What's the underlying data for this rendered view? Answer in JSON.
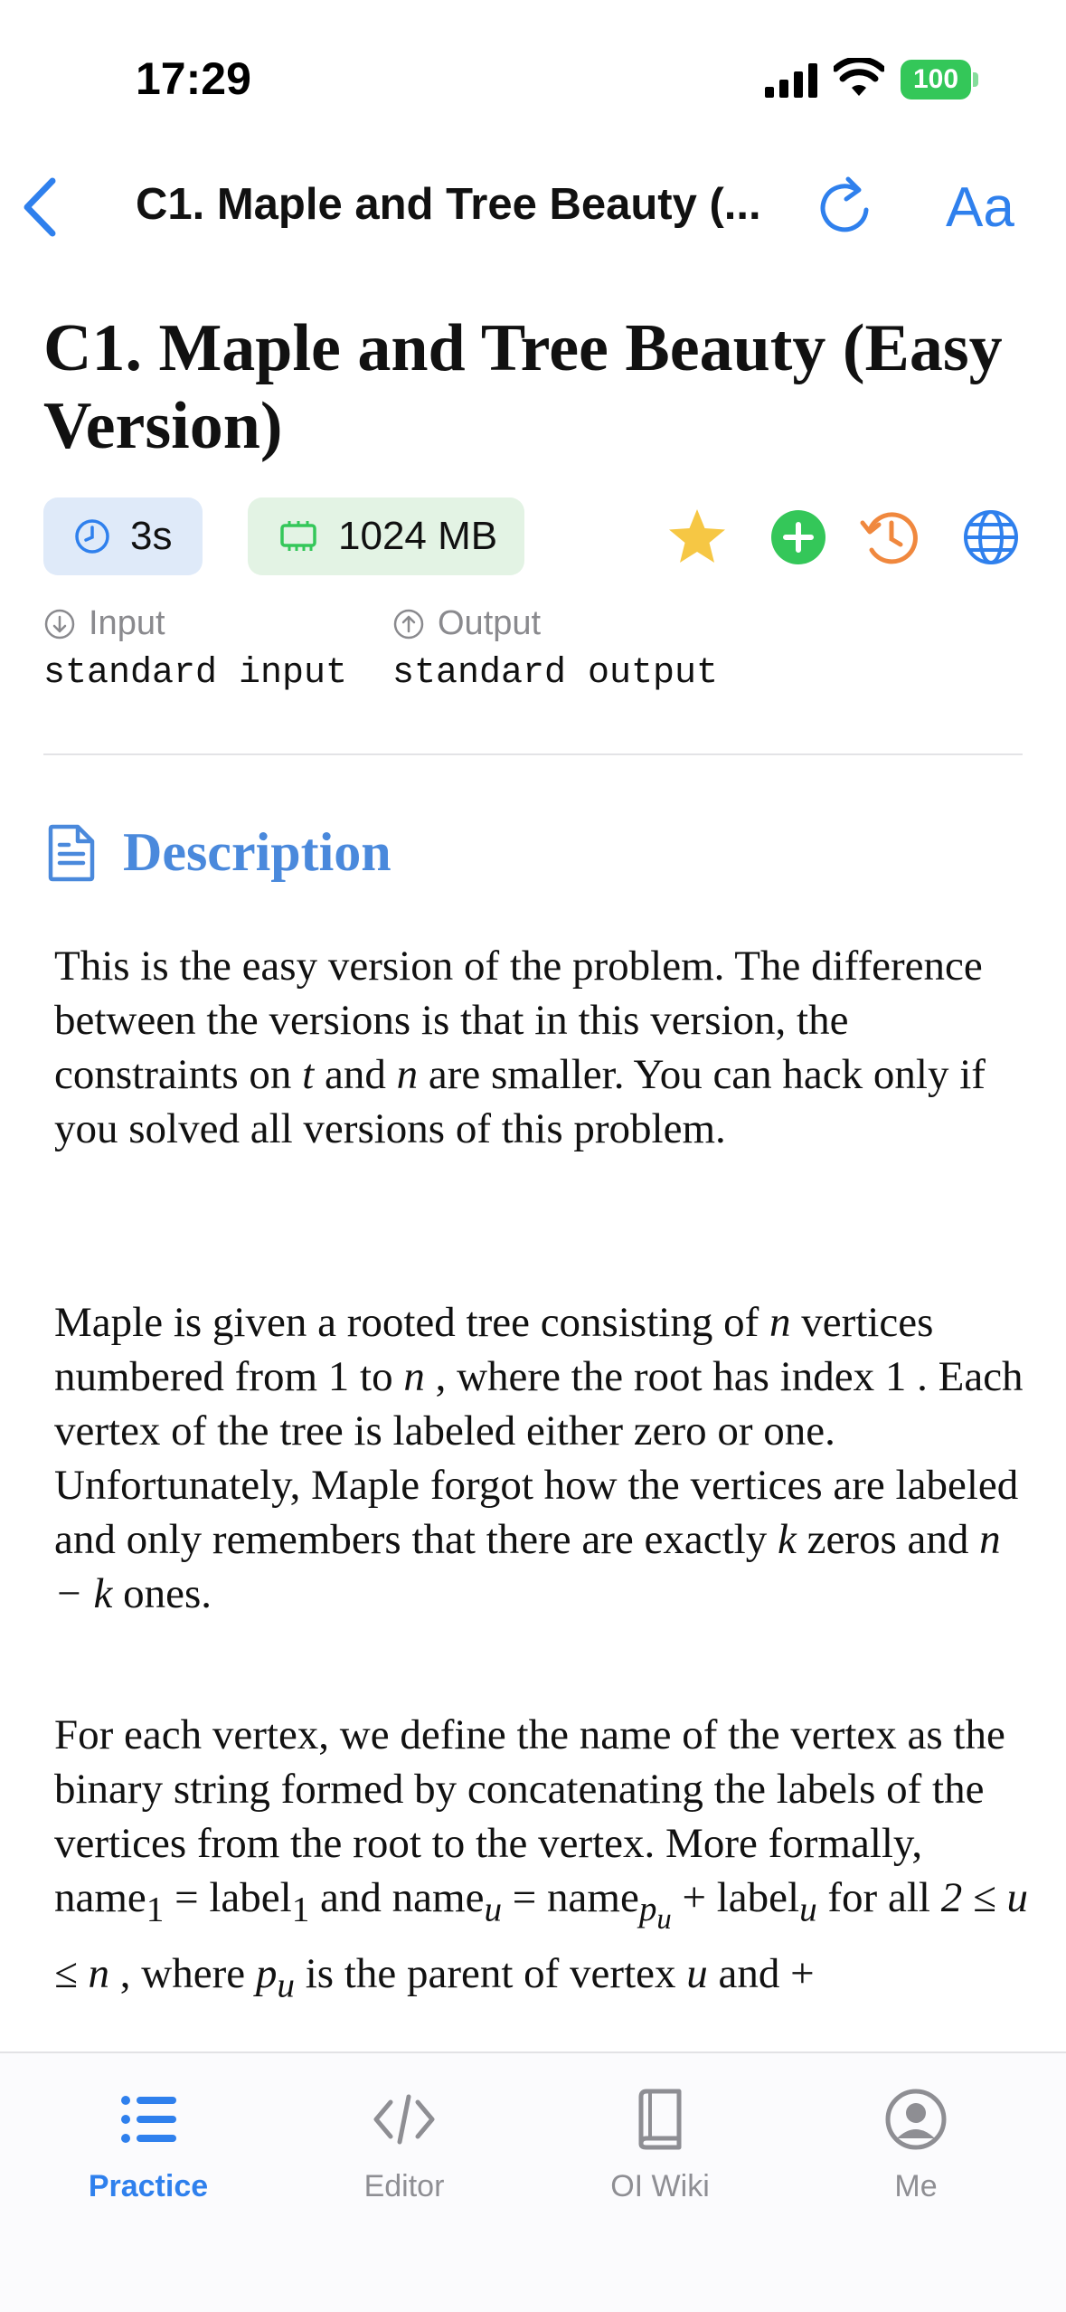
{
  "status_bar": {
    "time": "17:29",
    "battery": "100"
  },
  "nav": {
    "title": "C1. Maple and Tree Beauty (...",
    "font_button": "Aa"
  },
  "problem": {
    "title": "C1. Maple and Tree Beauty (Easy Version)",
    "time_limit": "3s",
    "memory_limit": "1024 MB",
    "input_label": "Input",
    "input_value": "standard input",
    "output_label": "Output",
    "output_value": "standard output"
  },
  "description": {
    "header": "Description",
    "p1": {
      "a": "This is the easy version of the problem. The difference between the versions is that in this version, the constraints on ",
      "m1": "t",
      "b": " and ",
      "m2": "n",
      "c": " are smaller. You can hack only if you solved all versions of this problem."
    },
    "p2": {
      "a": "Maple is given a rooted tree consisting of ",
      "m1": "n",
      "b": " vertices numbered from ",
      "m2": "1",
      "c": " to ",
      "m3": "n",
      "d": " , where the root has index ",
      "m4": "1",
      "e": " . Each vertex of the tree is labeled either zero or one. Unfortunately, Maple forgot how the vertices are labeled and only remembers that there are exactly ",
      "m5": "k",
      "f": " zeros and ",
      "m6": "n − k",
      "g": " ones."
    },
    "p3": {
      "a": "For each vertex, we define the name of the vertex as the binary string formed by concatenating the labels of the vertices from the root to the vertex. More formally, ",
      "m1": "name",
      "s1": "1",
      "m1b": " = label",
      "s2": "1",
      "b": " and ",
      "m2": "name",
      "s3": "u",
      "m2b": " = name",
      "s4": "p",
      "s4b": "u",
      "m2c": " + label",
      "s5": "u",
      "c": " for all ",
      "m3": "2 ≤ u ≤ n",
      "d": " , where ",
      "m4": "p",
      "s6": "u",
      "e": " is the parent of vertex ",
      "m5": "u",
      "f": " and ",
      "m6": "+"
    }
  },
  "tabs": [
    {
      "label": "Practice"
    },
    {
      "label": "Editor"
    },
    {
      "label": "OI Wiki"
    },
    {
      "label": "Me"
    }
  ],
  "colors": {
    "accent": "#2f80ed",
    "star": "#f6c744",
    "add": "#34c759",
    "history": "#f0883e"
  }
}
